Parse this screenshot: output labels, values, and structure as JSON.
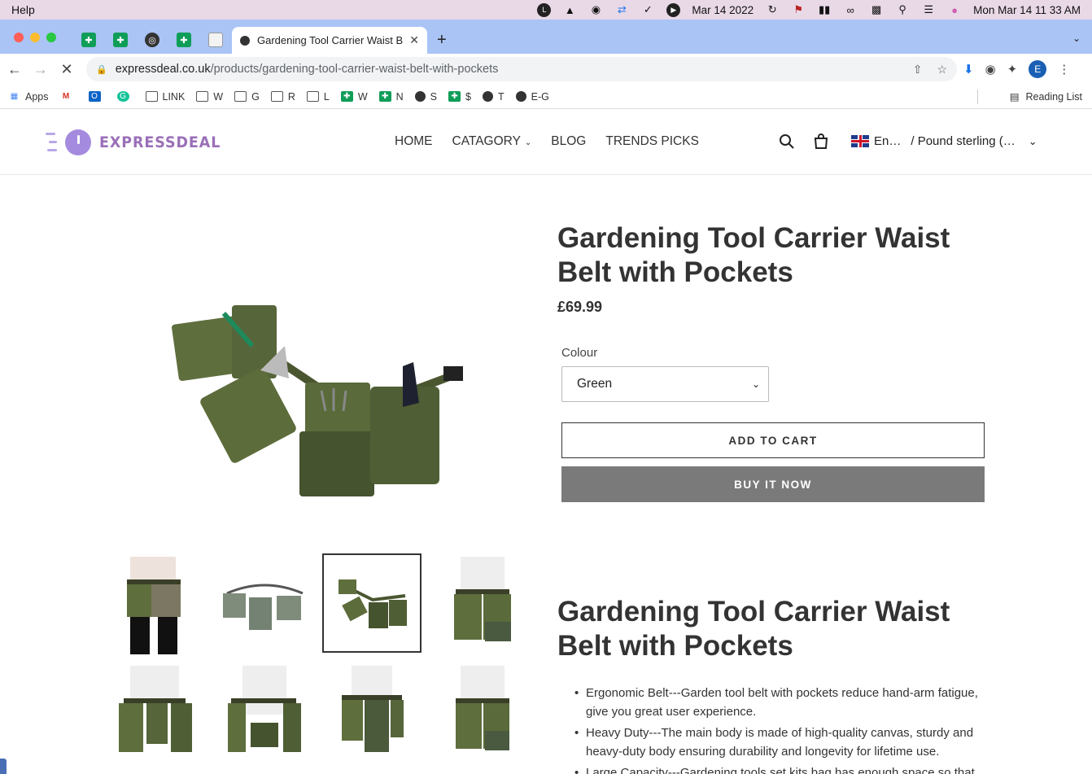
{
  "menubar": {
    "app_menu": "Help",
    "date": "Mar 14 2022",
    "clock": "Mon Mar 14  11 33 AM"
  },
  "browser": {
    "active_tab_title": "Gardening Tool Carrier Waist Belt with Pockets",
    "url_domain": "expressdeal.co.uk",
    "url_path": "/products/gardening-tool-carrier-waist-belt-with-pockets",
    "profile_initial": "E",
    "bookmarks": [
      {
        "label": "Apps",
        "icon": "apps-grid-icon"
      },
      {
        "label": "",
        "icon": "gmail-icon"
      },
      {
        "label": "",
        "icon": "outlook-icon"
      },
      {
        "label": "",
        "icon": "grammarly-icon"
      },
      {
        "label": "LINK",
        "icon": "folder-icon"
      },
      {
        "label": "W",
        "icon": "folder-icon"
      },
      {
        "label": "G",
        "icon": "folder-icon"
      },
      {
        "label": "R",
        "icon": "folder-icon"
      },
      {
        "label": "L",
        "icon": "folder-icon"
      },
      {
        "label": "W",
        "icon": "sheets-icon"
      },
      {
        "label": "N",
        "icon": "sheets-icon"
      },
      {
        "label": "S",
        "icon": "globe-icon"
      },
      {
        "label": "$",
        "icon": "sheets-icon"
      },
      {
        "label": "T",
        "icon": "globe-icon"
      },
      {
        "label": "E-G",
        "icon": "globe-icon"
      }
    ],
    "reading_list": "Reading List"
  },
  "site": {
    "logo_text": "EXPRESSDEAL",
    "nav": {
      "home": "HOME",
      "category": "CATAGORY",
      "blog": "BLOG",
      "trends": "TRENDS PICKS"
    },
    "language": "En…",
    "currency": "/ Pound sterling (…"
  },
  "product": {
    "title": "Gardening Tool Carrier Waist Belt with Pockets",
    "price": "£69.99",
    "colour_label": "Colour",
    "colour_value": "Green",
    "add_to_cart": "ADD TO CART",
    "buy_now": "BUY IT NOW",
    "description_title": "Gardening Tool Carrier Waist Belt with Pockets",
    "features": [
      "Ergonomic Belt---Garden tool belt with pockets reduce hand-arm fatigue, give you great user experience.",
      "Heavy Duty---The main body is made of high-quality canvas, sturdy and heavy-duty body ensuring durability and longevity for lifetime use.",
      "Large Capacity---Gardening tools set kits bag has enough space so that"
    ]
  },
  "colors": {
    "accent_logo": "#9a6fb8",
    "belt_green": "#5b6b3c",
    "buy_button": "#7a7a7a"
  }
}
